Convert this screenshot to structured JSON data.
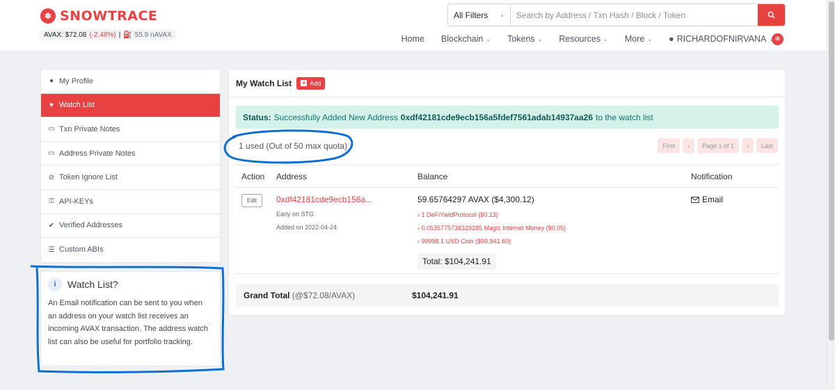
{
  "brand": {
    "name": "SNOWTRACE"
  },
  "price_bar": {
    "label": "AVAX: $72.08",
    "change": "(-2.48%)",
    "sep": "|",
    "gas": "55.9 nAVAX"
  },
  "search": {
    "filter": "All Filters",
    "placeholder": "Search by Address / Txn Hash / Block / Token"
  },
  "nav": {
    "items": [
      {
        "label": "Home",
        "dropdown": false
      },
      {
        "label": "Blockchain",
        "dropdown": true
      },
      {
        "label": "Tokens",
        "dropdown": true
      },
      {
        "label": "Resources",
        "dropdown": true
      },
      {
        "label": "More",
        "dropdown": true
      },
      {
        "label": "RICHARDOFNIRVANA",
        "dropdown": true
      }
    ]
  },
  "sidebar": {
    "items": [
      {
        "label": "My Profile",
        "icon": "user-circle-icon",
        "active": false
      },
      {
        "label": "Watch List",
        "icon": "heart-icon",
        "active": true
      },
      {
        "label": "Txn Private Notes",
        "icon": "note-icon",
        "active": false
      },
      {
        "label": "Address Private Notes",
        "icon": "note-icon",
        "active": false
      },
      {
        "label": "Token Ignore List",
        "icon": "eye-slash-icon",
        "active": false
      },
      {
        "label": "API-KEYs",
        "icon": "key-icon",
        "active": false
      },
      {
        "label": "Verified Addresses",
        "icon": "check-badge-icon",
        "active": false
      },
      {
        "label": "Custom ABIs",
        "icon": "list-icon",
        "active": false
      }
    ]
  },
  "info_box": {
    "title": "Watch List?",
    "text": "An Email notification can be sent to you when an address on your watch list receives an incoming AVAX transaction. The address watch list can also be useful for portfolio tracking."
  },
  "main": {
    "title": "My Watch List",
    "add_label": "Add",
    "status": {
      "prefix": "Status:",
      "message": "Successfully Added New Address",
      "address": "0xdf42181cde9ecb156a5fdef7561adab14937aa26",
      "suffix": "to the watch list"
    },
    "quota": "1 used (Out of 50 max quota)",
    "pager": {
      "first": "First",
      "prev": "‹",
      "page": "Page 1 of 1",
      "next": "›",
      "last": "Last"
    },
    "table": {
      "headers": [
        "Action",
        "Address",
        "Balance",
        "Notification"
      ],
      "rows": [
        {
          "edit": "Edit",
          "address": "0xdf42181cde9ecb156a...",
          "name_tag": "Early on STG",
          "added": "Added on 2022-04-24",
          "balance": "59.65764297 AVAX ($4,300.12)",
          "tokens": [
            "› 1 DeFiYieldProtocol ($0.13)",
            "› 0.0535775738329285 Magic Internet Money ($0.05)",
            "› 99998.1 USD Coin ($99,941.60)"
          ],
          "total": "Total: $104,241.91",
          "notification": "Email"
        }
      ]
    },
    "grand_total": {
      "label": "Grand Total",
      "rate": "(@$72.08/AVAX)",
      "value": "$104,241.91"
    }
  },
  "colors": {
    "accent": "#e84142",
    "status_bg": "#d4f1ea",
    "annotation": "#0f6fce"
  }
}
